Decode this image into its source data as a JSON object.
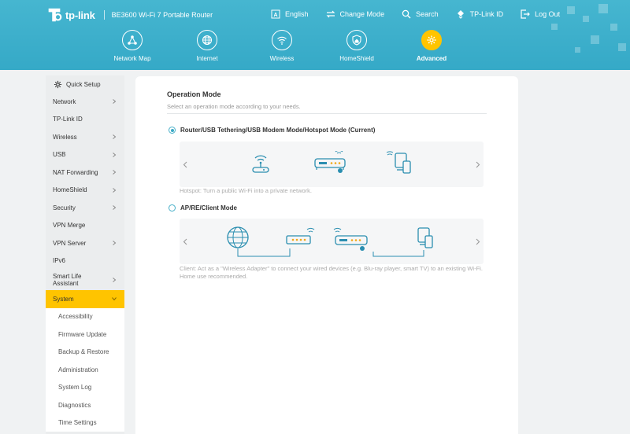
{
  "header": {
    "brand": "tp-link",
    "model": "BE3600 Wi-Fi 7 Portable Router",
    "links": [
      {
        "label": "English",
        "icon": "language-icon"
      },
      {
        "label": "Change Mode",
        "icon": "change-mode-icon"
      },
      {
        "label": "Search",
        "icon": "search-icon"
      },
      {
        "label": "TP-Link ID",
        "icon": "tplink-id-icon"
      },
      {
        "label": "Log Out",
        "icon": "logout-icon"
      }
    ],
    "nav": [
      {
        "label": "Network Map",
        "icon": "network-map-icon"
      },
      {
        "label": "Internet",
        "icon": "globe-icon"
      },
      {
        "label": "Wireless",
        "icon": "wifi-icon"
      },
      {
        "label": "HomeShield",
        "icon": "shield-home-icon"
      },
      {
        "label": "Advanced",
        "icon": "gear-icon",
        "active": true
      }
    ],
    "colors": {
      "header": "#3db0cc",
      "active": "#ffc400"
    }
  },
  "sidebar": {
    "quick_setup": "Quick Setup",
    "items": [
      {
        "label": "Network",
        "chevron": true
      },
      {
        "label": "TP-Link ID",
        "chevron": false
      },
      {
        "label": "Wireless",
        "chevron": true
      },
      {
        "label": "USB",
        "chevron": true
      },
      {
        "label": "NAT Forwarding",
        "chevron": true
      },
      {
        "label": "HomeShield",
        "chevron": true
      },
      {
        "label": "Security",
        "chevron": true
      },
      {
        "label": "VPN Merge",
        "chevron": false
      },
      {
        "label": "VPN Server",
        "chevron": true
      },
      {
        "label": "IPv6",
        "chevron": false
      },
      {
        "label": "Smart Life Assistant",
        "chevron": true
      },
      {
        "label": "System",
        "chevron": true,
        "active": true
      }
    ],
    "sub_items": [
      "Accessibility",
      "Firmware Update",
      "Backup & Restore",
      "Administration",
      "System Log",
      "Diagnostics",
      "Time Settings"
    ]
  },
  "main": {
    "title": "Operation Mode",
    "description": "Select an operation mode according to your needs.",
    "modes": [
      {
        "label": "Router/USB Tethering/USB Modem Mode/Hotspot Mode (Current)",
        "checked": true,
        "hint": "Hotspot: Turn a public Wi-Fi into a private network."
      },
      {
        "label": "AP/RE/Client Mode",
        "checked": false,
        "hint": "Client: Act as a \"Wireless Adapter\" to connect your wired devices (e.g. Blu-ray player, smart TV) to an existing Wi-Fi. Home use recommended."
      }
    ]
  }
}
